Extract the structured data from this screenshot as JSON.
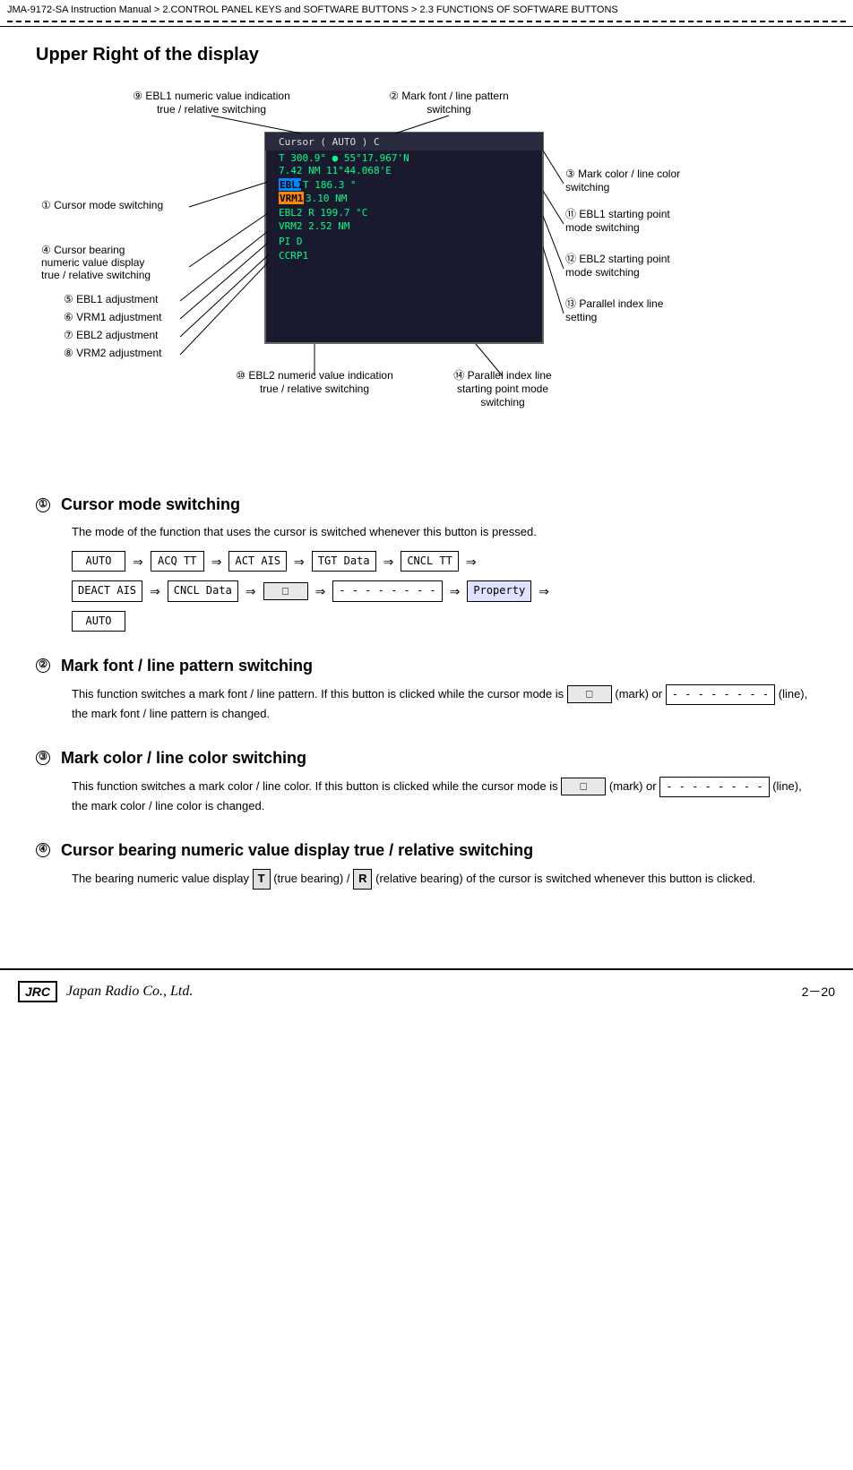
{
  "breadcrumb": {
    "text": "JMA-9172-SA Instruction Manual  >  2.CONTROL PANEL KEYS and SOFTWARE BUTTONS  >  2.3  FUNCTIONS OF SOFTWARE BUTTONS"
  },
  "page_title": "Upper Right of the display",
  "radar_display": {
    "top_row": "Cursor  (  AUTO  )  C",
    "row1": "T    300.9°  ●   55°17.967'N",
    "row2": "          7.42 NM    11°44.068'E",
    "ebl1_row": "EBL1 T  186.3  °",
    "vrm1_row": "VRM1     3.10   NM",
    "ebl2_row": "EBL2 R  199.7  °C",
    "vrm2_row": "VRM2     2.52   NM",
    "pi_row": "PI         D",
    "ccrp1_row": "CCRP1"
  },
  "annotations": {
    "num1": "① Cursor mode switching",
    "num2": "② Mark font / line pattern switching",
    "num3": "③ Mark color / line color switching",
    "num4": "④ Cursor bearing numeric value display true / relative switching",
    "num5": "⑤ EBL1 adjustment",
    "num6": "⑥ VRM1 adjustment",
    "num7": "⑦ EBL2 adjustment",
    "num8": "⑧ VRM2 adjustment",
    "num9": "⑨ EBL1 numeric value indication true / relative switching",
    "num10": "⑩ EBL2 numeric value indication true / relative switching",
    "num11": "⑪ EBL1 starting point mode switching",
    "num12": "⑫ EBL2 starting point mode switching",
    "num13": "⑬ Parallel index line setting",
    "num14": "⑭ Parallel index line starting point mode switching"
  },
  "sections": [
    {
      "num": "①",
      "title": "Cursor mode switching",
      "body": "The mode of the function that uses the cursor is switched whenever this button is pressed.",
      "flow": [
        "AUTO",
        "⇒",
        "ACQ TT",
        "⇒",
        "ACT AIS",
        "⇒",
        "TGT Data",
        "⇒",
        "CNCL TT",
        "⇒",
        "DEACT AIS",
        "⇒",
        "CNCL Data",
        "⇒",
        "□",
        "⇒",
        "- - - - - - - -",
        "⇒",
        "Property",
        "⇒",
        "AUTO"
      ]
    },
    {
      "num": "②",
      "title": "Mark font / line pattern switching",
      "body_pre": "This function switches a mark font / line pattern. If this button is clicked while the cursor mode is",
      "body_mark": "(mark) or",
      "body_dashes": "(line), the mark font / line pattern is changed.",
      "body_post": ""
    },
    {
      "num": "③",
      "title": "Mark color / line color switching",
      "body_pre": "This function switches a mark color / line color. If this button is clicked while the cursor mode is",
      "body_mark": "(mark) or",
      "body_dashes": "(line), the mark color / line color is changed.",
      "body_post": ""
    },
    {
      "num": "④",
      "title": "Cursor bearing numeric value display true / relative switching",
      "body_pre": "The bearing numeric value display",
      "t_label": "T",
      "body_mid": "(true bearing) /",
      "r_label": "R",
      "body_end": "(relative bearing) of the cursor is switched whenever this button is clicked."
    }
  ],
  "footer": {
    "jrc_label": "JRC",
    "company": "Japan Radio Co., Ltd.",
    "page": "2－20"
  }
}
